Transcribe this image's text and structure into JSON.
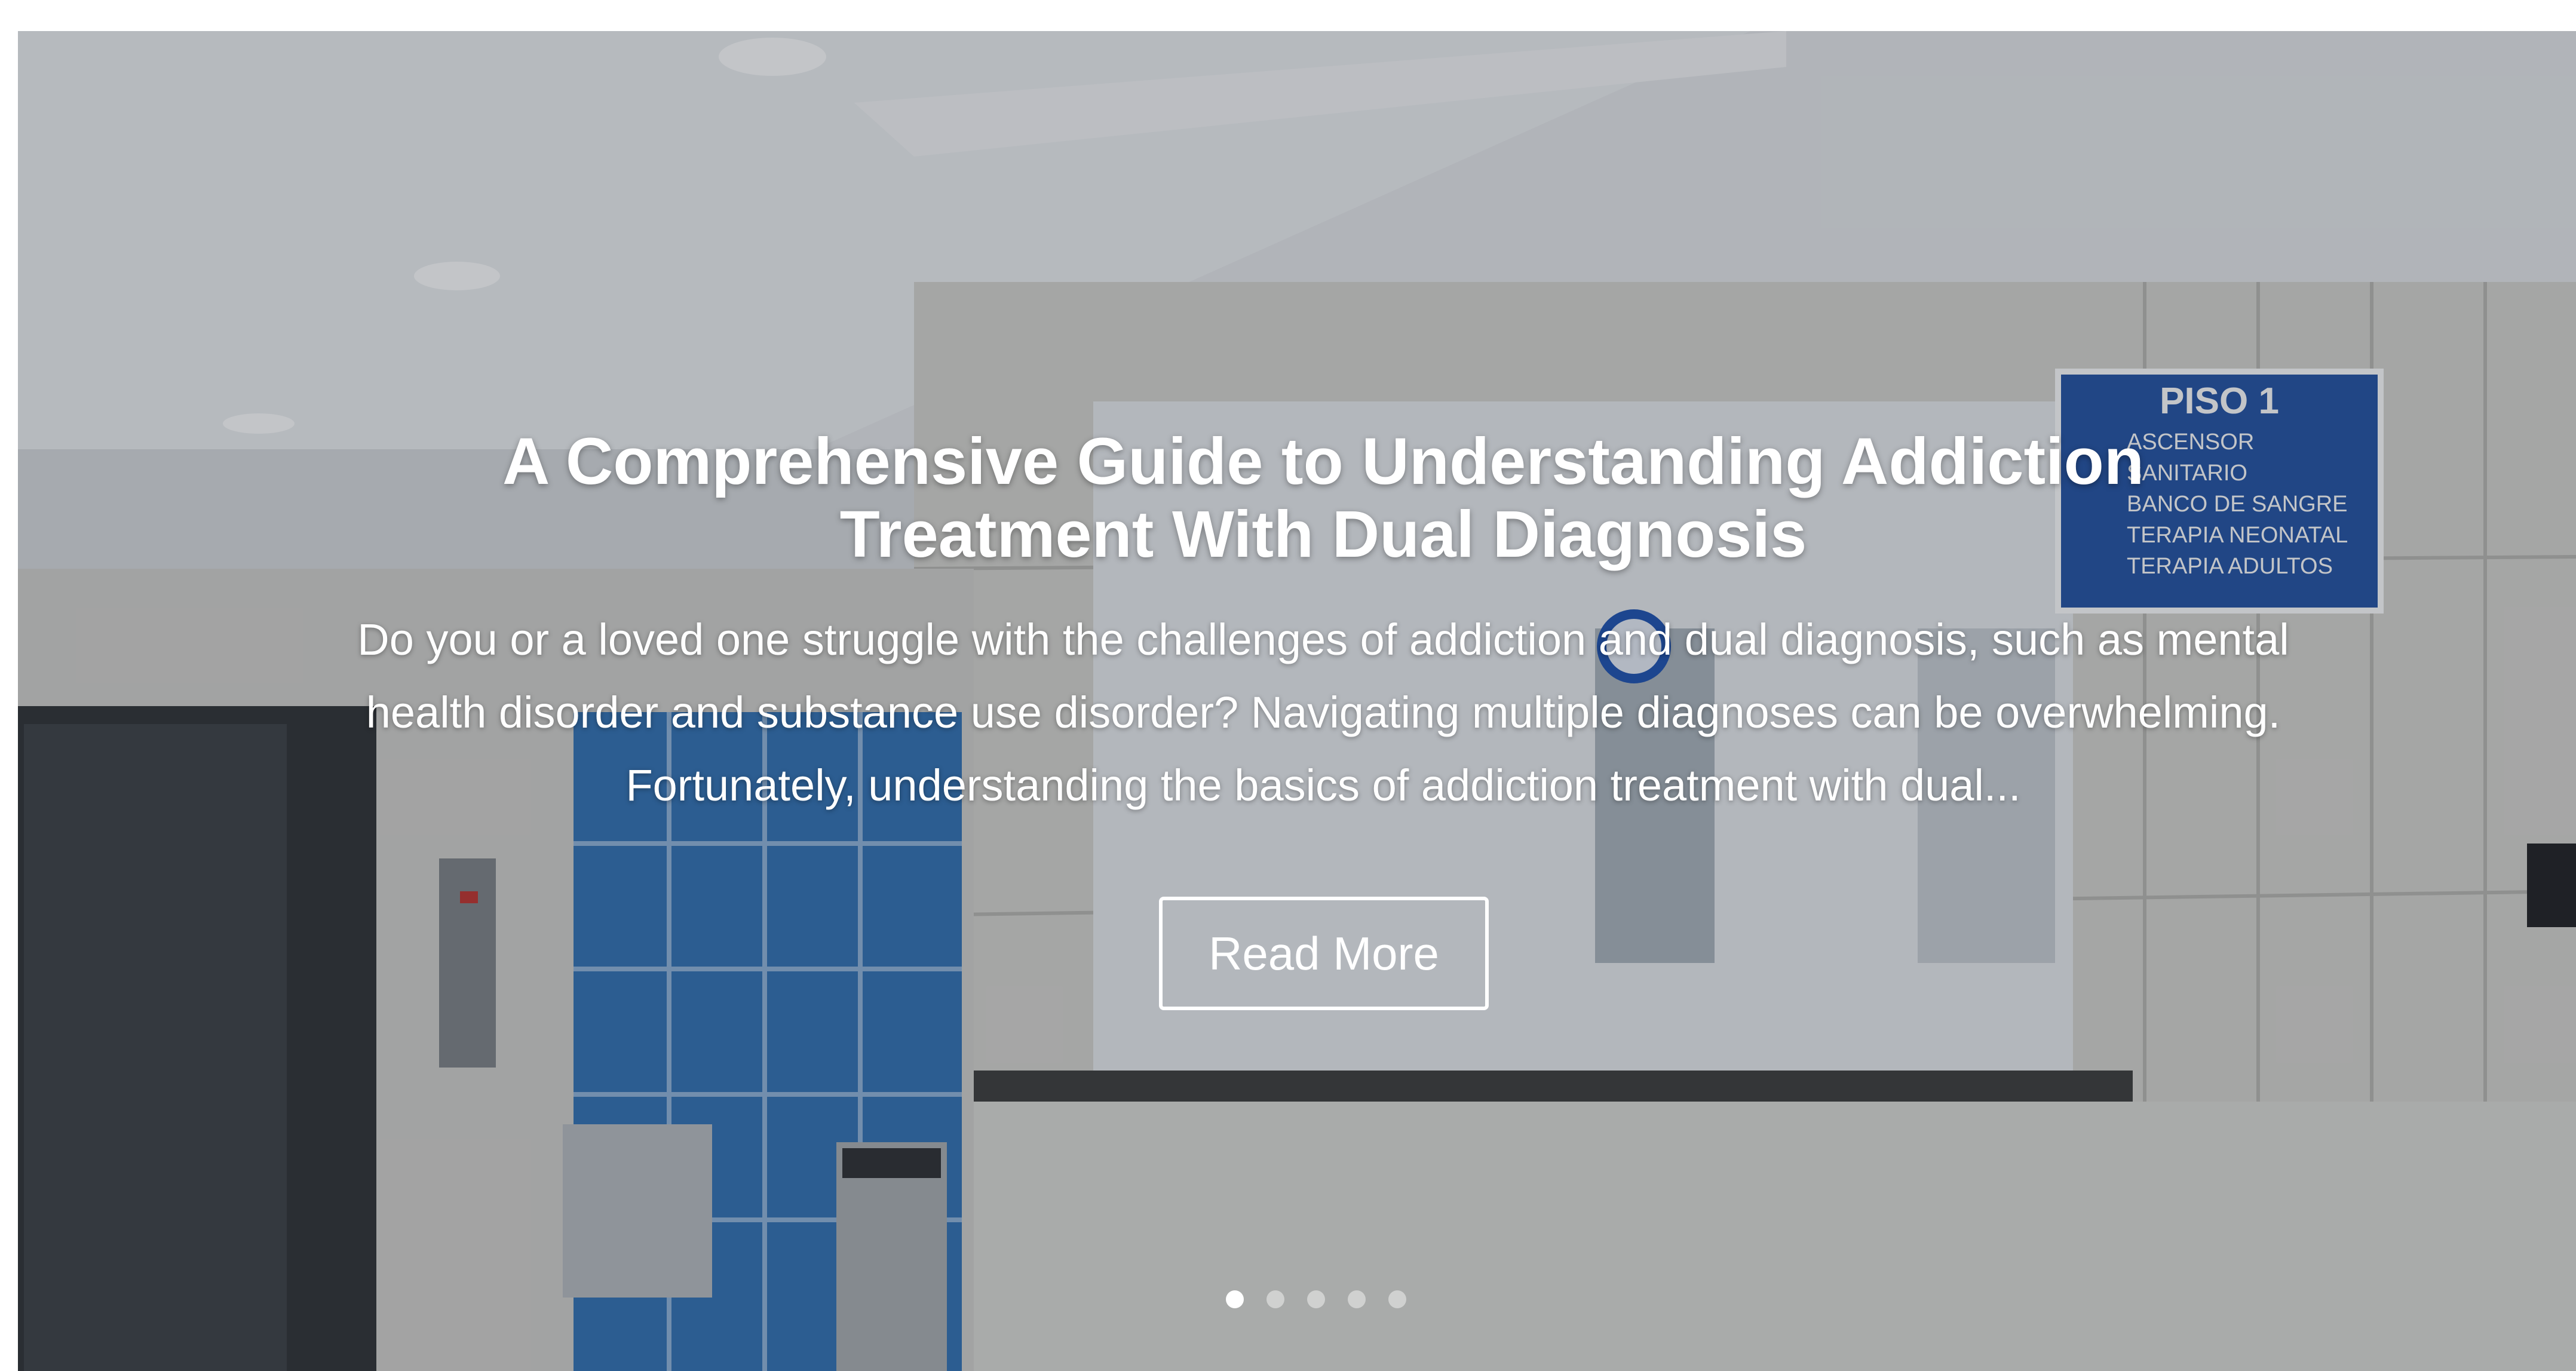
{
  "hero": {
    "title": "A Comprehensive Guide to Understanding Addiction Treatment With Dual Diagnosis",
    "excerpt": "Do you or a loved one struggle with the challenges of addiction and dual diagnosis, such as mental health disorder and substance use disorder? Navigating multiple diagnoses can be overwhelming. Fortunately, understanding the basics of addiction treatment with dual...",
    "button_label": "Read More"
  },
  "background_sign": {
    "heading": "PISO 1",
    "lines": [
      "ASCENSOR",
      "SANITARIO",
      "BANCO DE SANGRE",
      "TERAPIA NEONATAL",
      "TERAPIA ADULTOS"
    ]
  },
  "slider": {
    "slide_count": 5,
    "active_index": 0
  },
  "colors": {
    "overlay": "#28303a",
    "text": "#ffffff",
    "tile_blue": "#2f6fb3",
    "sign_blue": "#1f4fa3"
  }
}
